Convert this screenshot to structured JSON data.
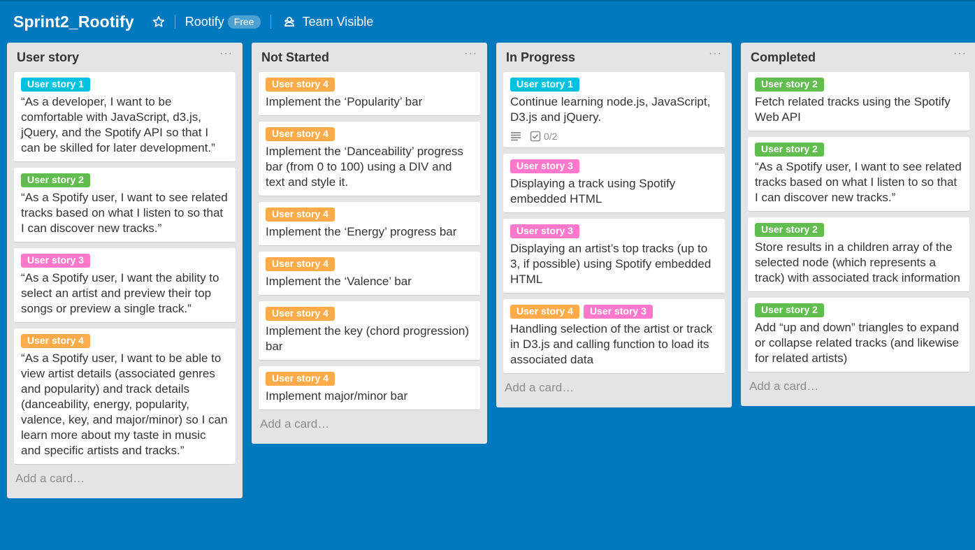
{
  "board": {
    "title": "Sprint2_Rootify",
    "org": "Rootify",
    "plan": "Free",
    "visibility": "Team Visible"
  },
  "icons": [
    "star-icon",
    "team-icon",
    "description-icon",
    "checklist-icon",
    "list-menu-icon"
  ],
  "colors": {
    "background": "#0079bf",
    "list": "#e2e4e6",
    "label_blue": "#00c2e0",
    "label_green": "#61bd4f",
    "label_pink": "#ff78cb",
    "label_orange": "#ffab4a"
  },
  "lists": [
    {
      "title": "User story",
      "menu": "···",
      "add_card": "Add a card…",
      "cards": [
        {
          "labels": [
            {
              "text": "User story 1",
              "color": "blue"
            }
          ],
          "text": "“As a developer, I want to be comfortable with JavaScript, d3.js, jQuery, and the Spotify API so that I can be skilled for later development.”"
        },
        {
          "labels": [
            {
              "text": "User story 2",
              "color": "green"
            }
          ],
          "text": "“As a Spotify user, I want to see related tracks based on what I listen to so that I can discover new tracks.”"
        },
        {
          "labels": [
            {
              "text": "User story 3",
              "color": "pink"
            }
          ],
          "text": "“As a Spotify user, I want the ability to select an artist and preview their top songs or preview a single track.”"
        },
        {
          "labels": [
            {
              "text": "User story 4",
              "color": "orange"
            }
          ],
          "text": "“As a Spotify user, I want to be able to view artist details (associated genres and popularity) and track details (danceability, energy, popularity, valence, key, and major/minor) so I can learn more about my taste in music and specific artists and tracks.”"
        }
      ]
    },
    {
      "title": "Not Started",
      "menu": "···",
      "add_card": "Add a card…",
      "cards": [
        {
          "labels": [
            {
              "text": "User story 4",
              "color": "orange"
            }
          ],
          "text": "Implement the ‘Popularity’ bar"
        },
        {
          "labels": [
            {
              "text": "User story 4",
              "color": "orange"
            }
          ],
          "text": "Implement the ‘Danceability’ progress bar (from 0 to 100) using a DIV and text and style it."
        },
        {
          "labels": [
            {
              "text": "User story 4",
              "color": "orange"
            }
          ],
          "text": "Implement the ‘Energy’ progress bar"
        },
        {
          "labels": [
            {
              "text": "User story 4",
              "color": "orange"
            }
          ],
          "text": "Implement the ‘Valence’ bar"
        },
        {
          "labels": [
            {
              "text": "User story 4",
              "color": "orange"
            }
          ],
          "text": "Implement the key (chord progression) bar"
        },
        {
          "labels": [
            {
              "text": "User story 4",
              "color": "orange"
            }
          ],
          "text": "Implement major/minor bar"
        }
      ]
    },
    {
      "title": "In Progress",
      "menu": "···",
      "add_card": "Add a card…",
      "cards": [
        {
          "labels": [
            {
              "text": "User story 1",
              "color": "blue"
            }
          ],
          "text": "Continue learning node.js, JavaScript, D3.js and jQuery.",
          "checklist": "0/2"
        },
        {
          "labels": [
            {
              "text": "User story 3",
              "color": "pink"
            }
          ],
          "text": "Displaying a track using Spotify embedded HTML"
        },
        {
          "labels": [
            {
              "text": "User story 3",
              "color": "pink"
            }
          ],
          "text": "Displaying an artist’s top tracks (up to 3, if possible) using Spotify embedded HTML"
        },
        {
          "labels": [
            {
              "text": "User story 4",
              "color": "orange"
            },
            {
              "text": "User story 3",
              "color": "pink"
            }
          ],
          "text": "Handling selection of the artist or track in D3.js and calling function to load its associated data"
        }
      ]
    },
    {
      "title": "Completed",
      "menu": "···",
      "add_card": "Add a card…",
      "cards": [
        {
          "labels": [
            {
              "text": "User story 2",
              "color": "green"
            }
          ],
          "text": "Fetch related tracks using the Spotify Web API"
        },
        {
          "labels": [
            {
              "text": "User story 2",
              "color": "green"
            }
          ],
          "text": "“As a Spotify user, I want to see related tracks based on what I listen to so that I can discover new tracks.”"
        },
        {
          "labels": [
            {
              "text": "User story 2",
              "color": "green"
            }
          ],
          "text": "Store results in a children array of the selected node (which represents a track) with associated track information"
        },
        {
          "labels": [
            {
              "text": "User story 2",
              "color": "green"
            }
          ],
          "text": "Add “up and down” triangles to expand or collapse related tracks (and likewise for related artists)"
        }
      ]
    }
  ]
}
